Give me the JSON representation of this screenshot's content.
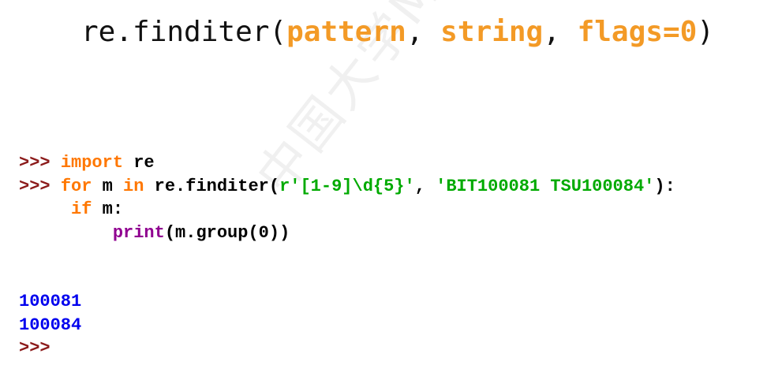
{
  "signature": {
    "func": "re.finditer(",
    "param1": "pattern",
    "sep1": ", ",
    "param2": "string",
    "sep2": ", ",
    "param3": "flags=0",
    "close": ")"
  },
  "code": {
    "prompt": ">>>",
    "line1": {
      "keyword": "import",
      "rest": " re"
    },
    "line2": {
      "kw_for": "for",
      "var": " m ",
      "kw_in": "in",
      "call": " re.finditer(",
      "pattern_arg": "r'[1-9]\\d{5}'",
      "comma": ", ",
      "string_arg": "'BIT100081 TSU100084'",
      "end": "):"
    },
    "line3": {
      "keyword": "if",
      "rest": " m:"
    },
    "line4": {
      "builtin": "print",
      "rest": "(m.group(0))"
    }
  },
  "output": {
    "lines": [
      "100081",
      "100084"
    ],
    "prompt": ">>>"
  },
  "colors": {
    "param": "#f39a26",
    "prompt": "#8b1a1a",
    "keyword": "#ff7700",
    "builtin": "#900090",
    "string": "#00aa00",
    "output": "#0000ee"
  },
  "watermark": "中国大学MOOC网络爬虫与信息提取"
}
